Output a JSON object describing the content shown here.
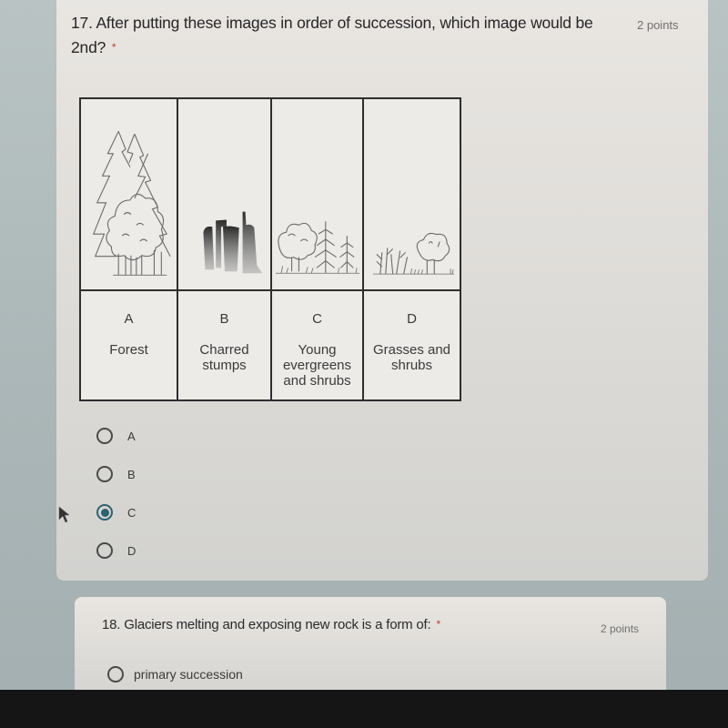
{
  "questions": [
    {
      "number": "17.",
      "text": "After putting these images in order of succession, which image would be 2nd?",
      "required_marker": "*",
      "points": "2 points",
      "figure": {
        "panels": [
          {
            "letter": "A",
            "description": "Forest",
            "icon": "forest-trees-icon"
          },
          {
            "letter": "B",
            "description": "Charred stumps",
            "icon": "charred-stumps-icon"
          },
          {
            "letter": "C",
            "description": "Young evergreens and shrubs",
            "icon": "young-evergreens-icon"
          },
          {
            "letter": "D",
            "description": "Grasses and shrubs",
            "icon": "grasses-shrubs-icon"
          }
        ]
      },
      "options": [
        {
          "label": "A",
          "selected": false
        },
        {
          "label": "B",
          "selected": false
        },
        {
          "label": "C",
          "selected": true
        },
        {
          "label": "D",
          "selected": false
        }
      ]
    },
    {
      "number": "18.",
      "text": "Glaciers melting and exposing new rock is a form of:",
      "required_marker": "*",
      "points": "2 points",
      "options": [
        {
          "label": "primary succession",
          "selected": false
        }
      ]
    }
  ],
  "colors": {
    "radio_selected": "#2f6271",
    "required_asterisk": "#c0392b"
  }
}
